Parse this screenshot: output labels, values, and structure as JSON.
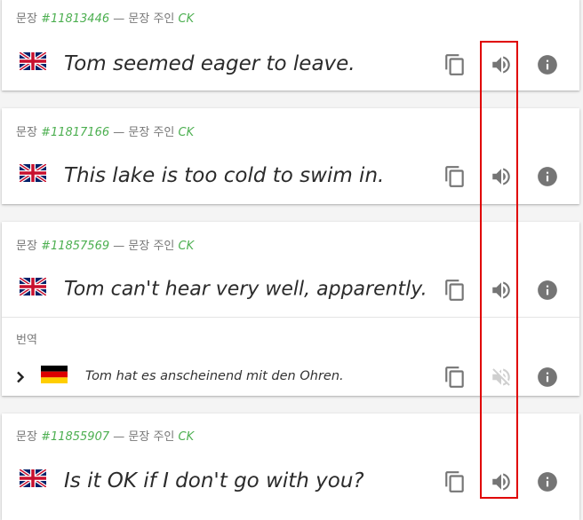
{
  "labels": {
    "sentence": "문장",
    "dash": "—",
    "owner_label": "문장 주인",
    "translations": "번역"
  },
  "sentences": [
    {
      "id": "#11813446",
      "owner": "CK",
      "lang": "eng",
      "text": "Tom seemed eager to leave."
    },
    {
      "id": "#11817166",
      "owner": "CK",
      "lang": "eng",
      "text": "This lake is too cold to swim in."
    },
    {
      "id": "#11857569",
      "owner": "CK",
      "lang": "eng",
      "text": "Tom can't hear very well, apparently.",
      "translation": {
        "lang": "deu",
        "text": "Tom hat es anscheinend mit den Ohren.",
        "audio": "unavailable"
      }
    },
    {
      "id": "#11855907",
      "owner": "CK",
      "lang": "eng",
      "text": "Is it OK if I don't go with you?"
    }
  ],
  "icons": {
    "copy": "copy-icon",
    "audio": "speaker-icon",
    "audio_off": "speaker-muted-icon",
    "info": "info-icon",
    "flag_en": "uk-flag-icon",
    "flag_de": "germany-flag-icon",
    "expand": "chevron-right-icon"
  },
  "colors": {
    "accent_green": "#4caf50",
    "highlight": "#e00000",
    "icon_gray": "#757575",
    "icon_disabled": "#cfcfcf"
  }
}
